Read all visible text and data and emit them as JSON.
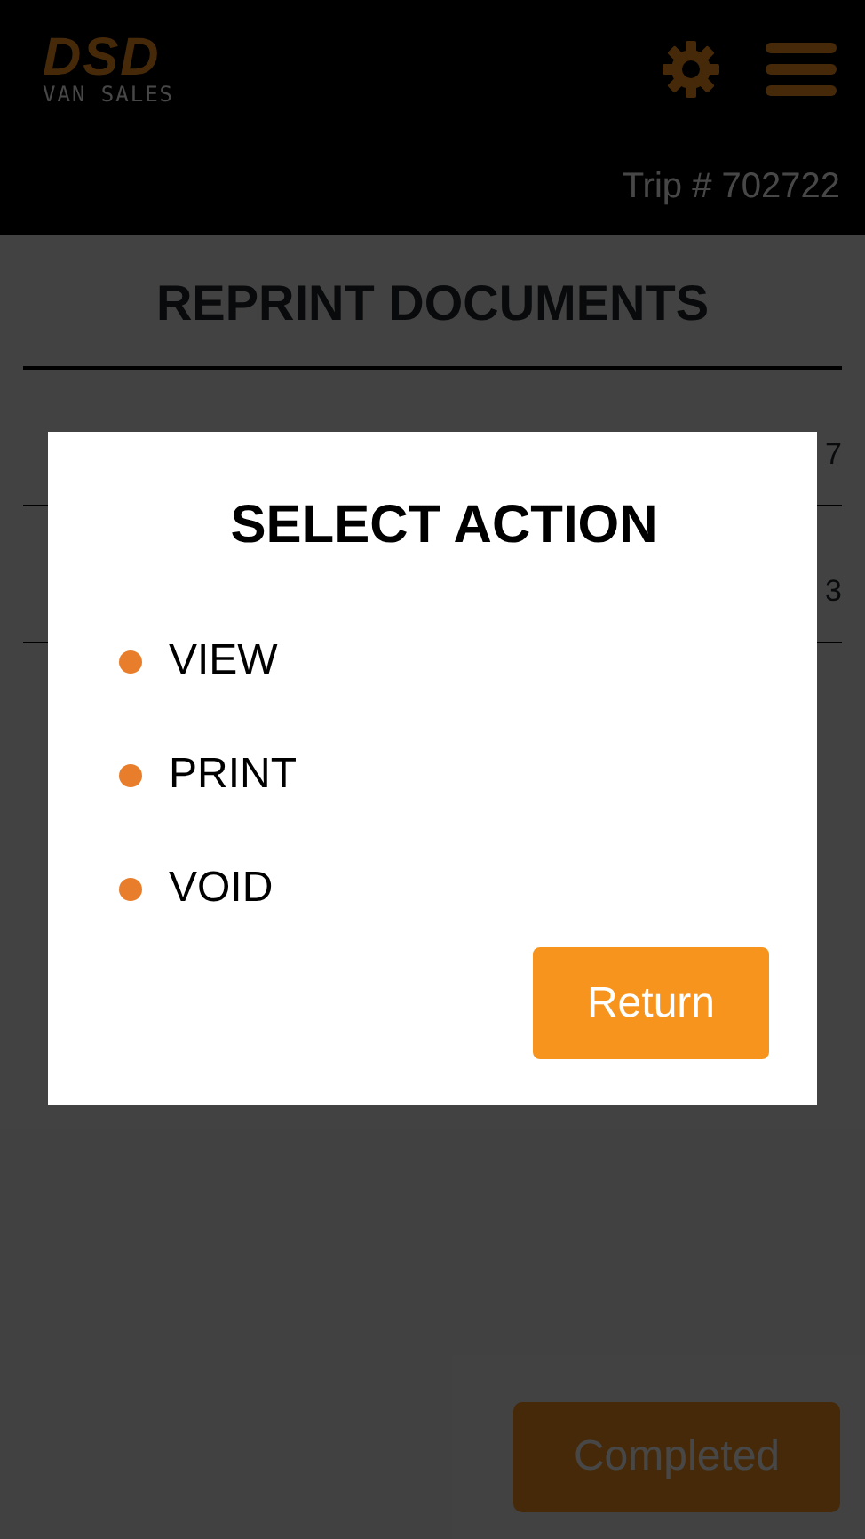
{
  "header": {
    "logo_mark": "DSD",
    "logo_subtitle": "VAN SALES"
  },
  "trip_bar": {
    "text": "Trip # 702722"
  },
  "page": {
    "title": "REPRINT DOCUMENTS",
    "rows": [
      {
        "value": "7"
      },
      {
        "value": "3"
      }
    ],
    "completed_button": "Completed"
  },
  "modal": {
    "title": "SELECT ACTION",
    "actions": [
      {
        "label": "VIEW",
        "color": "#e87e2b"
      },
      {
        "label": "PRINT",
        "color": "#e87e2b"
      },
      {
        "label": "VOID",
        "color": "#e87e2b"
      }
    ],
    "return_button": "Return"
  }
}
